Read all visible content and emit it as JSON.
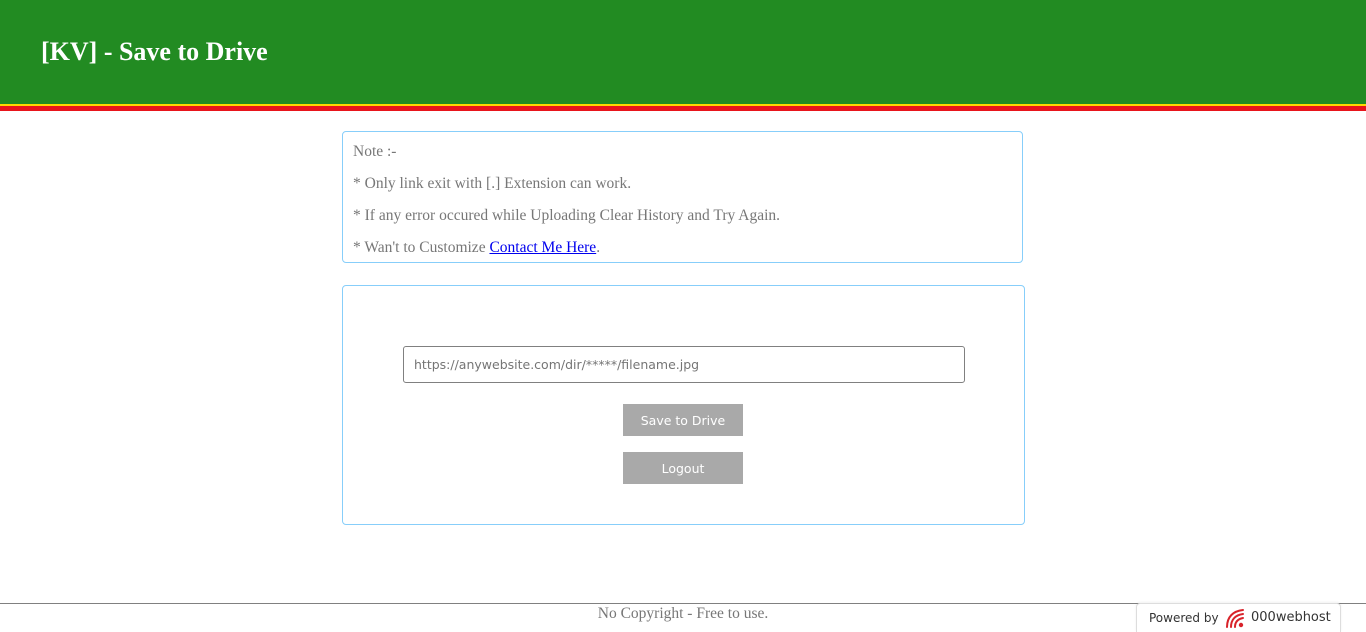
{
  "header": {
    "title": "[KV] - Save to Drive",
    "bg_color": "#228b22",
    "stripe_colors": [
      "#ffd700",
      "#e8141b"
    ]
  },
  "notes": {
    "heading": "Note :-",
    "line1": "* Only link exit with [.] Extension can work.",
    "line2": "* If any error occured while Uploading Clear History and Try Again.",
    "line3_prefix": "* Wan't to Customize ",
    "line3_link": "Contact Me Here",
    "line3_suffix": "."
  },
  "form": {
    "url_placeholder": "https://anywebsite.com/dir/*****/filename.jpg",
    "url_value": "",
    "save_button": "Save to Drive",
    "logout_button": "Logout"
  },
  "footer": {
    "text": "No Copyright - Free to use."
  },
  "powered_by": {
    "label": "Powered by",
    "brand": "000webhost",
    "logo_icon": "000webhost-logo-icon"
  }
}
